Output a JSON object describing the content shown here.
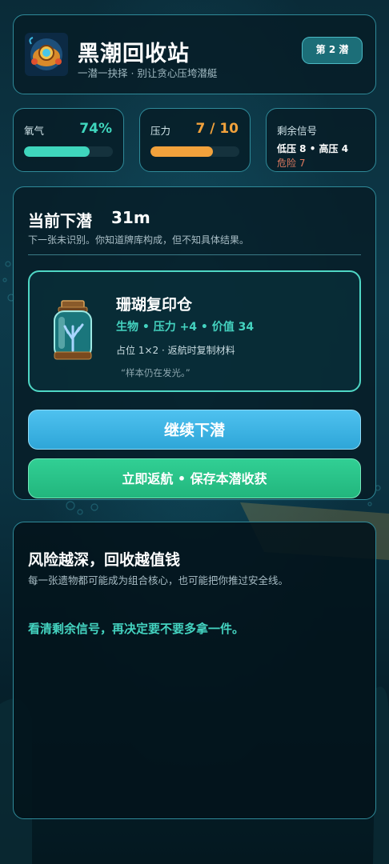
{
  "header": {
    "title": "黑潮回收站",
    "subtitle": "一潜一抉择 · 别让贪心压垮潜艇",
    "dive_badge": "第 2 潜"
  },
  "stats": {
    "oxygen": {
      "label": "氧气",
      "value_text": "74%",
      "fraction": 0.74,
      "color": "#3fd6bd"
    },
    "pressure": {
      "label": "压力",
      "value_text": "7 / 10",
      "current": 7,
      "max": 10,
      "color": "#f2a23c"
    },
    "signals": {
      "label": "剩余信号",
      "summary": "低压 8 • 高压 4",
      "danger": "危险 7"
    }
  },
  "dive": {
    "title": "当前下潜",
    "depth": "31m",
    "description": "下一张未识别。你知道牌库构成，但不知具体结果。"
  },
  "relic": {
    "name": "珊瑚复印仓",
    "stats": "生物 • 压力 +4 • 价值 34",
    "slot_info": "占位 1×2 · 返航时复制材料",
    "quote": "“样本仍在发光。”",
    "icon": "coral-jar-icon"
  },
  "actions": {
    "continue_label": "继续下潜",
    "return_label": "立即返航 • 保存本潜收获"
  },
  "info": {
    "title": "风险越深，回收越值钱",
    "description": "每一张遗物都可能成为组合核心，也可能把你推过安全线。",
    "tip": "看清剩余信号，再决定要不要多拿一件。"
  },
  "colors": {
    "accent_teal": "#44d3c0",
    "continue_blue": "#3ab4e6",
    "return_green": "#2ac489",
    "danger_red": "#e07a5f"
  }
}
